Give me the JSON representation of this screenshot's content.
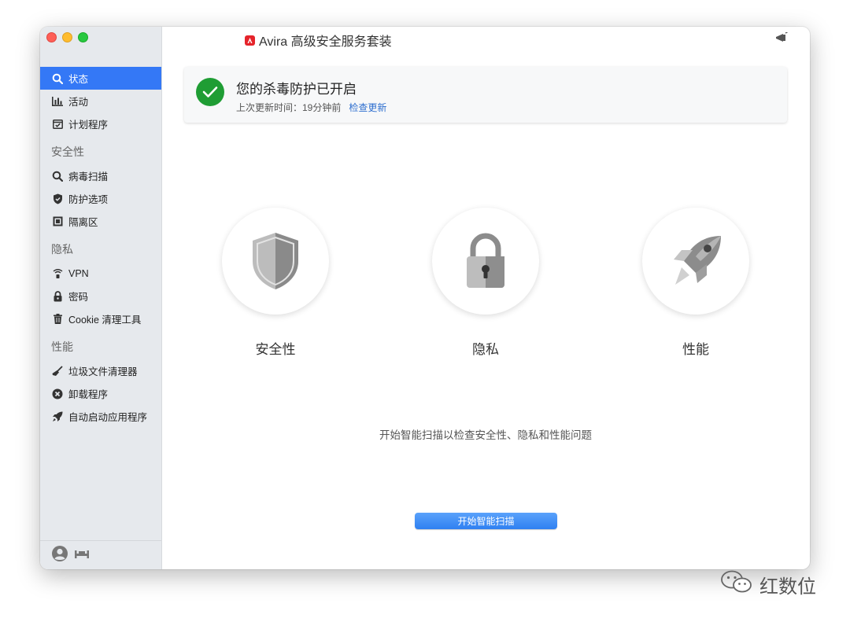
{
  "window": {
    "title": "Avira 高级安全服务套装"
  },
  "sidebar": {
    "items": [
      {
        "label": "状态",
        "icon": "status-search-icon",
        "active": true
      },
      {
        "label": "活动",
        "icon": "bar-chart-icon"
      },
      {
        "label": "计划程序",
        "icon": "calendar-check-icon"
      }
    ],
    "sections": [
      {
        "title": "安全性",
        "items": [
          {
            "label": "病毒扫描",
            "icon": "scan-search-icon"
          },
          {
            "label": "防护选项",
            "icon": "shield-check-icon"
          },
          {
            "label": "隔离区",
            "icon": "quarantine-icon"
          }
        ]
      },
      {
        "title": "隐私",
        "items": [
          {
            "label": "VPN",
            "icon": "wifi-lock-icon"
          },
          {
            "label": "密码",
            "icon": "lock-icon"
          },
          {
            "label": "Cookie 清理工具",
            "icon": "trash-icon"
          }
        ]
      },
      {
        "title": "性能",
        "items": [
          {
            "label": "垃圾文件清理器",
            "icon": "broom-icon"
          },
          {
            "label": "卸载程序",
            "icon": "close-circle-icon"
          },
          {
            "label": "自动启动应用程序",
            "icon": "rocket-icon"
          }
        ]
      }
    ]
  },
  "status": {
    "title": "您的杀毒防护已开启",
    "last_update": "上次更新时间：19分钟前",
    "check_link": "检查更新"
  },
  "features": [
    {
      "label": "安全性",
      "icon": "shield-icon"
    },
    {
      "label": "隐私",
      "icon": "padlock-icon"
    },
    {
      "label": "性能",
      "icon": "rocket-icon"
    }
  ],
  "hint": "开始智能扫描以检查安全性、隐私和性能问题",
  "scan_button": "开始智能扫描",
  "watermark": "红数位",
  "colors": {
    "accent": "#3478f6",
    "success": "#1f9d34",
    "brand": "#e5242b"
  }
}
